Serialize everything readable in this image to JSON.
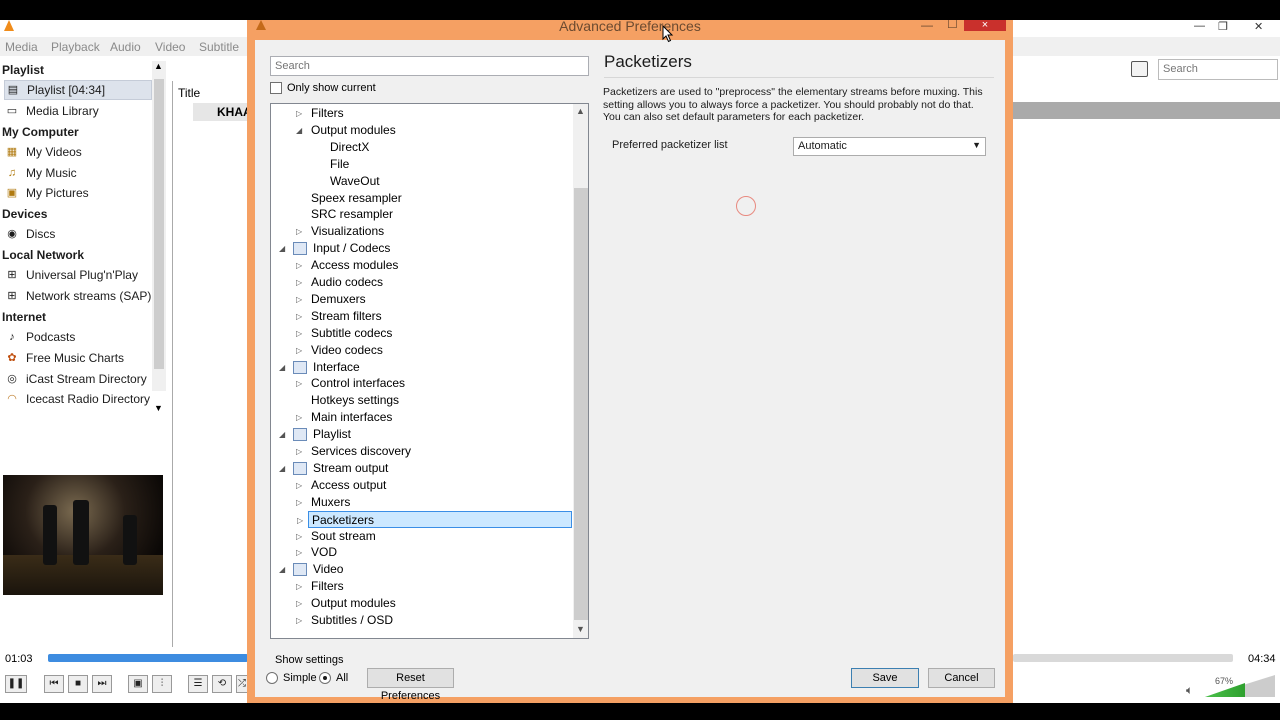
{
  "vlc": {
    "menu": [
      "Media",
      "Playback",
      "Audio",
      "Video",
      "Subtitle"
    ],
    "sidebar": {
      "playlist_heading": "Playlist",
      "playlist_item": "Playlist [04:34]",
      "media_library": "Media Library",
      "my_computer_heading": "My Computer",
      "my_videos": "My Videos",
      "my_music": "My Music",
      "my_pictures": "My Pictures",
      "devices_heading": "Devices",
      "discs": "Discs",
      "local_network_heading": "Local Network",
      "upnp": "Universal Plug'n'Play",
      "sap": "Network streams (SAP)",
      "internet_heading": "Internet",
      "podcasts": "Podcasts",
      "free_music_charts": "Free Music Charts",
      "icast": "iCast Stream Directory",
      "icecast": "Icecast Radio Directory"
    },
    "playlist": {
      "title_col": "Title",
      "row1": "KHAA",
      "search_placeholder": "Search"
    },
    "time_elapsed": "01:03",
    "time_total": "04:34",
    "volume": "67%"
  },
  "dialog": {
    "title": "Advanced Preferences",
    "close_label": "×",
    "search_placeholder": "Search",
    "only_show_current": "Only show current",
    "tree": [
      {
        "label": "Filters",
        "level": 2,
        "arrow": "right"
      },
      {
        "label": "Output modules",
        "level": 2,
        "arrow": "down"
      },
      {
        "label": "DirectX",
        "level": 3,
        "arrow": ""
      },
      {
        "label": "File",
        "level": 3,
        "arrow": ""
      },
      {
        "label": "WaveOut",
        "level": 3,
        "arrow": ""
      },
      {
        "label": "Speex resampler",
        "level": 2,
        "arrow": ""
      },
      {
        "label": "SRC resampler",
        "level": 2,
        "arrow": ""
      },
      {
        "label": "Visualizations",
        "level": 2,
        "arrow": "right"
      },
      {
        "label": "Input / Codecs",
        "level": 1,
        "arrow": "down",
        "icon": "input-codecs-icon"
      },
      {
        "label": "Access modules",
        "level": 2,
        "arrow": "right"
      },
      {
        "label": "Audio codecs",
        "level": 2,
        "arrow": "right"
      },
      {
        "label": "Demuxers",
        "level": 2,
        "arrow": "right"
      },
      {
        "label": "Stream filters",
        "level": 2,
        "arrow": "right"
      },
      {
        "label": "Subtitle codecs",
        "level": 2,
        "arrow": "right"
      },
      {
        "label": "Video codecs",
        "level": 2,
        "arrow": "right"
      },
      {
        "label": "Interface",
        "level": 1,
        "arrow": "down",
        "icon": "interface-icon"
      },
      {
        "label": "Control interfaces",
        "level": 2,
        "arrow": "right"
      },
      {
        "label": "Hotkeys settings",
        "level": 2,
        "arrow": ""
      },
      {
        "label": "Main interfaces",
        "level": 2,
        "arrow": "right"
      },
      {
        "label": "Playlist",
        "level": 1,
        "arrow": "down",
        "icon": "playlist-icon"
      },
      {
        "label": "Services discovery",
        "level": 2,
        "arrow": "right"
      },
      {
        "label": "Stream output",
        "level": 1,
        "arrow": "down",
        "icon": "stream-output-icon"
      },
      {
        "label": "Access output",
        "level": 2,
        "arrow": "right"
      },
      {
        "label": "Muxers",
        "level": 2,
        "arrow": "right"
      },
      {
        "label": "Packetizers",
        "level": 2,
        "arrow": "right",
        "selected": true
      },
      {
        "label": "Sout stream",
        "level": 2,
        "arrow": "right"
      },
      {
        "label": "VOD",
        "level": 2,
        "arrow": "right"
      },
      {
        "label": "Video",
        "level": 1,
        "arrow": "down",
        "icon": "video-icon"
      },
      {
        "label": "Filters",
        "level": 2,
        "arrow": "right"
      },
      {
        "label": "Output modules",
        "level": 2,
        "arrow": "right"
      },
      {
        "label": "Subtitles / OSD",
        "level": 2,
        "arrow": "right"
      }
    ],
    "pane": {
      "title": "Packetizers",
      "description": "Packetizers are used to \"preprocess\" the elementary streams before muxing. This setting allows you to always force a packetizer. You should probably not do that. You can also set default parameters for each packetizer.",
      "field_label": "Preferred packetizer list",
      "field_value": "Automatic"
    },
    "show_settings": "Show settings",
    "radio_simple": "Simple",
    "radio_all": "All",
    "reset_button": "Reset Preferences",
    "save_button": "Save",
    "cancel_button": "Cancel"
  },
  "colors": {
    "dialog_frame": "#f5a063",
    "selection": "#cce8ff",
    "seek": "#3d8ce0"
  }
}
